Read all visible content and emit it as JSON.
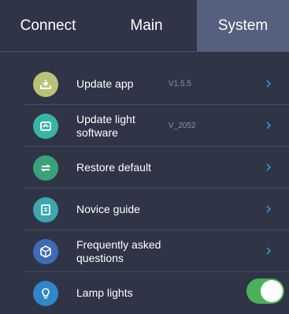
{
  "tabs": [
    {
      "label": "Connect"
    },
    {
      "label": "Main"
    },
    {
      "label": "System",
      "active": true
    }
  ],
  "items": [
    {
      "label": "Update app",
      "version": "V1.5.5",
      "icon": "download-tray-icon",
      "color": "#b9c275"
    },
    {
      "label": "Update light software",
      "version": "V_2052",
      "icon": "lamp-update-icon",
      "color": "#37b5a8"
    },
    {
      "label": "Restore default",
      "icon": "restore-arrows-icon",
      "color": "#3aa27a"
    },
    {
      "label": "Novice guide",
      "icon": "guide-document-icon",
      "color": "#3ba7b0"
    },
    {
      "label": "Frequently asked questions",
      "icon": "faq-cube-icon",
      "color": "#3e6bb6"
    },
    {
      "label": "Lamp lights",
      "icon": "lightbulb-icon",
      "color": "#2f86c8",
      "toggle_on": true
    }
  ],
  "colors": {
    "background": "#2f3546",
    "active_tab": "#55607e",
    "toggle_on": "#4cb05a",
    "chevron": "#3b8fd6"
  }
}
